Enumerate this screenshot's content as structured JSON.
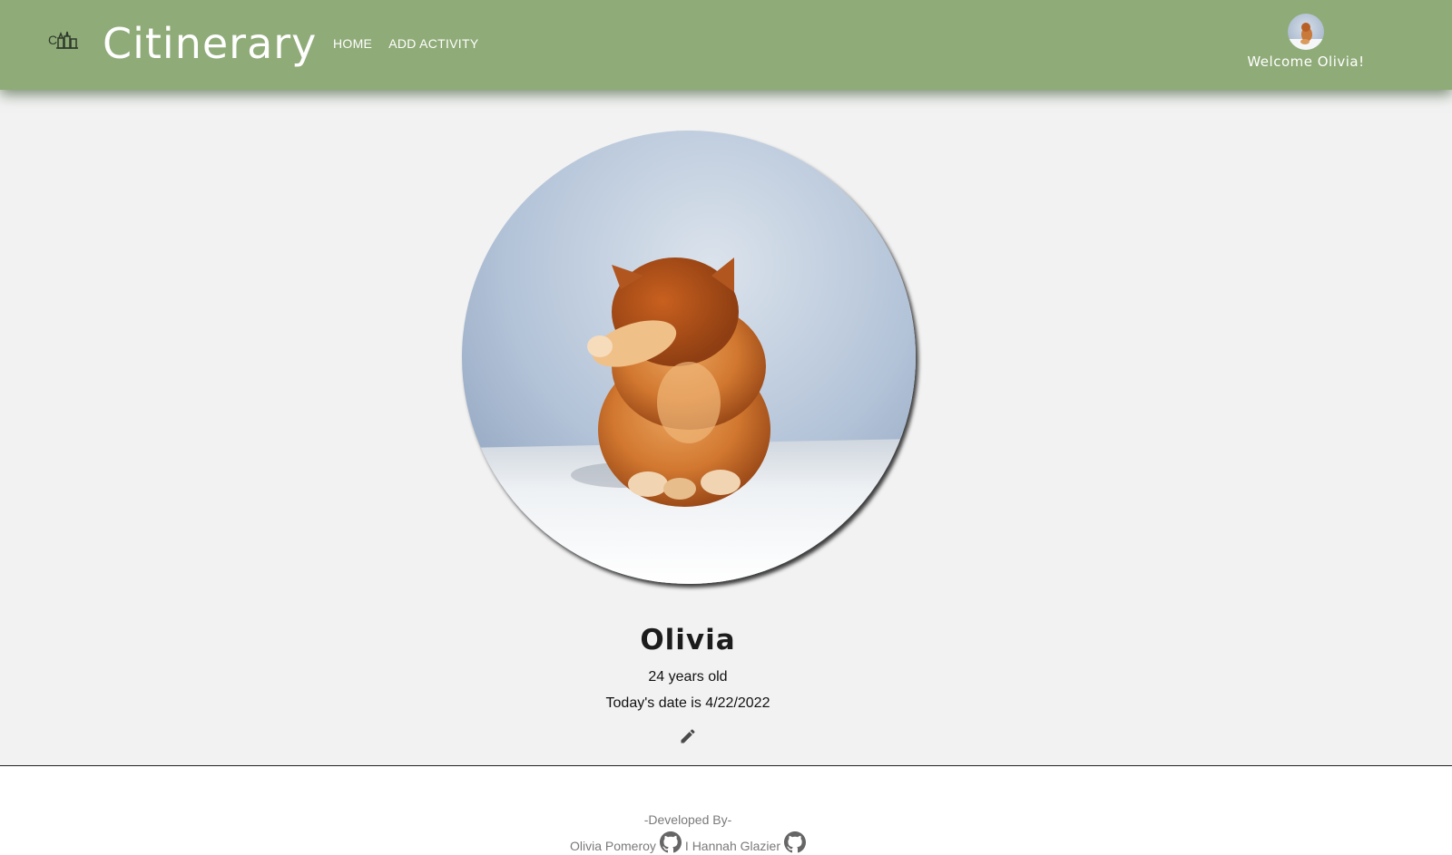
{
  "header": {
    "logo_icon": "city-skyline-icon",
    "title": "Citinerary",
    "nav": [
      {
        "label": "HOME"
      },
      {
        "label": "ADD ACTIVITY"
      }
    ],
    "welcome": "Welcome Olivia!",
    "background_color": "#8fab78"
  },
  "profile": {
    "name": "Olivia",
    "age_text": "24 years old",
    "date_text": "Today's date is 4/22/2022",
    "edit_icon": "pencil-icon"
  },
  "footer": {
    "developed_by": "-Developed By-",
    "developers": [
      {
        "name": "Olivia Pomeroy",
        "icon": "github-icon"
      },
      {
        "name": "I Hannah Glazier",
        "icon": "github-icon"
      }
    ]
  }
}
